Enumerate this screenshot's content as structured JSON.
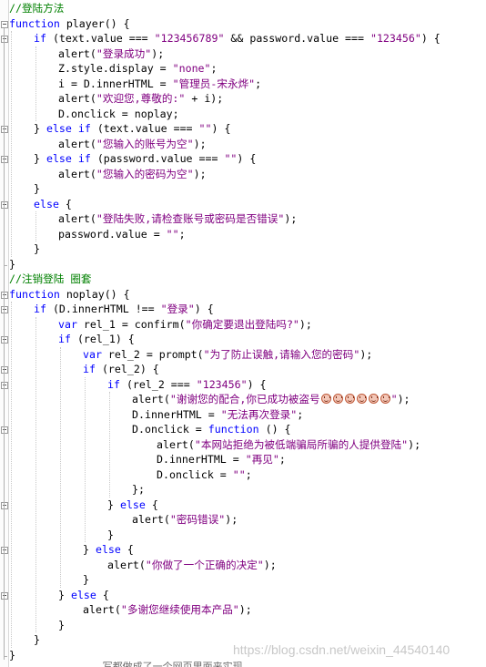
{
  "code": {
    "line_height": 16.5,
    "lines": [
      {
        "indent": 0,
        "tokens": [
          {
            "t": "//登陆方法",
            "c": "cmt"
          }
        ]
      },
      {
        "indent": 0,
        "fold": true,
        "tokens": [
          {
            "t": "function",
            "c": "kw"
          },
          {
            "t": " player() {"
          }
        ]
      },
      {
        "indent": 1,
        "fold": true,
        "tokens": [
          {
            "t": "if",
            "c": "kw"
          },
          {
            "t": " (text.value === "
          },
          {
            "t": "\"123456789\"",
            "c": "str"
          },
          {
            "t": " && password.value === "
          },
          {
            "t": "\"123456\"",
            "c": "str"
          },
          {
            "t": ") {"
          }
        ]
      },
      {
        "indent": 2,
        "tokens": [
          {
            "t": "alert("
          },
          {
            "t": "\"登录成功\"",
            "c": "str"
          },
          {
            "t": ");"
          }
        ]
      },
      {
        "indent": 2,
        "tokens": [
          {
            "t": "Z.style.display = "
          },
          {
            "t": "\"none\"",
            "c": "str"
          },
          {
            "t": ";"
          }
        ]
      },
      {
        "indent": 2,
        "tokens": [
          {
            "t": "i = D.innerHTML = "
          },
          {
            "t": "\"管理员-宋永烨\"",
            "c": "str"
          },
          {
            "t": ";"
          }
        ]
      },
      {
        "indent": 2,
        "tokens": [
          {
            "t": "alert("
          },
          {
            "t": "\"欢迎您,尊敬的:\"",
            "c": "str"
          },
          {
            "t": " + i);"
          }
        ]
      },
      {
        "indent": 2,
        "tokens": [
          {
            "t": "D.onclick = noplay;"
          }
        ]
      },
      {
        "indent": 1,
        "fold": true,
        "tokens": [
          {
            "t": "} "
          },
          {
            "t": "else if",
            "c": "kw"
          },
          {
            "t": " (text.value === "
          },
          {
            "t": "\"\"",
            "c": "str"
          },
          {
            "t": ") {"
          }
        ]
      },
      {
        "indent": 2,
        "tokens": [
          {
            "t": "alert("
          },
          {
            "t": "\"您输入的账号为空\"",
            "c": "str"
          },
          {
            "t": ");"
          }
        ]
      },
      {
        "indent": 1,
        "fold": true,
        "tokens": [
          {
            "t": "} "
          },
          {
            "t": "else if",
            "c": "kw"
          },
          {
            "t": " (password.value === "
          },
          {
            "t": "\"\"",
            "c": "str"
          },
          {
            "t": ") {"
          }
        ]
      },
      {
        "indent": 2,
        "tokens": [
          {
            "t": "alert("
          },
          {
            "t": "\"您输入的密码为空\"",
            "c": "str"
          },
          {
            "t": ");"
          }
        ]
      },
      {
        "indent": 1,
        "tokens": [
          {
            "t": "}"
          }
        ]
      },
      {
        "indent": 1,
        "fold": true,
        "tokens": [
          {
            "t": "else",
            "c": "kw"
          },
          {
            "t": " {"
          }
        ]
      },
      {
        "indent": 2,
        "tokens": [
          {
            "t": "alert("
          },
          {
            "t": "\"登陆失败,请检查账号或密码是否错误\"",
            "c": "str"
          },
          {
            "t": ");"
          }
        ]
      },
      {
        "indent": 2,
        "tokens": [
          {
            "t": "password.value = "
          },
          {
            "t": "\"\"",
            "c": "str"
          },
          {
            "t": ";"
          }
        ]
      },
      {
        "indent": 1,
        "tokens": [
          {
            "t": "}"
          }
        ]
      },
      {
        "indent": 0,
        "tokens": [
          {
            "t": "}"
          }
        ]
      },
      {
        "indent": 0,
        "tokens": [
          {
            "t": "//注销登陆 圈套",
            "c": "cmt"
          }
        ]
      },
      {
        "indent": 0,
        "fold": true,
        "tokens": [
          {
            "t": "function",
            "c": "kw"
          },
          {
            "t": " noplay() {"
          }
        ]
      },
      {
        "indent": 1,
        "fold": true,
        "tokens": [
          {
            "t": "if",
            "c": "kw"
          },
          {
            "t": " (D.innerHTML !== "
          },
          {
            "t": "\"登录\"",
            "c": "str"
          },
          {
            "t": ") {"
          }
        ]
      },
      {
        "indent": 2,
        "tokens": [
          {
            "t": "var",
            "c": "kw"
          },
          {
            "t": " rel_1 = confirm("
          },
          {
            "t": "\"你确定要退出登陆吗?\"",
            "c": "str"
          },
          {
            "t": ");"
          }
        ]
      },
      {
        "indent": 2,
        "fold": true,
        "tokens": [
          {
            "t": "if",
            "c": "kw"
          },
          {
            "t": " (rel_1) {"
          }
        ]
      },
      {
        "indent": 3,
        "tokens": [
          {
            "t": "var",
            "c": "kw"
          },
          {
            "t": " rel_2 = prompt("
          },
          {
            "t": "\"为了防止误触,请输入您的密码\"",
            "c": "str"
          },
          {
            "t": ");"
          }
        ]
      },
      {
        "indent": 3,
        "fold": true,
        "tokens": [
          {
            "t": "if",
            "c": "kw"
          },
          {
            "t": " (rel_2) {"
          }
        ]
      },
      {
        "indent": 4,
        "fold": true,
        "tokens": [
          {
            "t": "if",
            "c": "kw"
          },
          {
            "t": " (rel_2 === "
          },
          {
            "t": "\"123456\"",
            "c": "str"
          },
          {
            "t": ") {"
          }
        ]
      },
      {
        "indent": 5,
        "tokens": [
          {
            "t": "alert("
          },
          {
            "t": "\"谢谢您的配合,你已成功被盗号",
            "c": "str"
          },
          {
            "emoji": 6
          },
          {
            "t": "\"",
            "c": "str"
          },
          {
            "t": ");"
          }
        ]
      },
      {
        "indent": 5,
        "tokens": [
          {
            "t": "D.innerHTML = "
          },
          {
            "t": "\"无法再次登录\"",
            "c": "str"
          },
          {
            "t": ";"
          }
        ]
      },
      {
        "indent": 5,
        "fold": true,
        "tokens": [
          {
            "t": "D.onclick = "
          },
          {
            "t": "function",
            "c": "kw"
          },
          {
            "t": " () {"
          }
        ]
      },
      {
        "indent": 6,
        "tokens": [
          {
            "t": "alert("
          },
          {
            "t": "\"本网站拒绝为被低端骗局所骗的人提供登陆\"",
            "c": "str"
          },
          {
            "t": ");"
          }
        ]
      },
      {
        "indent": 6,
        "tokens": [
          {
            "t": "D.innerHTML = "
          },
          {
            "t": "\"再见\"",
            "c": "str"
          },
          {
            "t": ";"
          }
        ]
      },
      {
        "indent": 6,
        "tokens": [
          {
            "t": "D.onclick = "
          },
          {
            "t": "\"\"",
            "c": "str"
          },
          {
            "t": ";"
          }
        ]
      },
      {
        "indent": 5,
        "tokens": [
          {
            "t": "};"
          }
        ]
      },
      {
        "indent": 4,
        "fold": true,
        "tokens": [
          {
            "t": "} "
          },
          {
            "t": "else",
            "c": "kw"
          },
          {
            "t": " {"
          }
        ]
      },
      {
        "indent": 5,
        "tokens": [
          {
            "t": "alert("
          },
          {
            "t": "\"密码错误\"",
            "c": "str"
          },
          {
            "t": ");"
          }
        ]
      },
      {
        "indent": 4,
        "tokens": [
          {
            "t": "}"
          }
        ]
      },
      {
        "indent": 3,
        "fold": true,
        "tokens": [
          {
            "t": "} "
          },
          {
            "t": "else",
            "c": "kw"
          },
          {
            "t": " {"
          }
        ]
      },
      {
        "indent": 4,
        "tokens": [
          {
            "t": "alert("
          },
          {
            "t": "\"你做了一个正确的决定\"",
            "c": "str"
          },
          {
            "t": ");"
          }
        ]
      },
      {
        "indent": 3,
        "tokens": [
          {
            "t": "}"
          }
        ]
      },
      {
        "indent": 2,
        "fold": true,
        "tokens": [
          {
            "t": "} "
          },
          {
            "t": "else",
            "c": "kw"
          },
          {
            "t": " {"
          }
        ]
      },
      {
        "indent": 3,
        "tokens": [
          {
            "t": "alert("
          },
          {
            "t": "\"多谢您继续使用本产品\"",
            "c": "str"
          },
          {
            "t": ");"
          }
        ]
      },
      {
        "indent": 2,
        "tokens": [
          {
            "t": "}"
          }
        ]
      },
      {
        "indent": 1,
        "tokens": [
          {
            "t": "}"
          }
        ]
      },
      {
        "indent": 0,
        "tokens": [
          {
            "t": "}"
          }
        ]
      }
    ]
  },
  "watermark": "https://blog.csdn.net/weixin_44540140",
  "cutoff_text": "                 写都做成了一个网页里面来实现"
}
